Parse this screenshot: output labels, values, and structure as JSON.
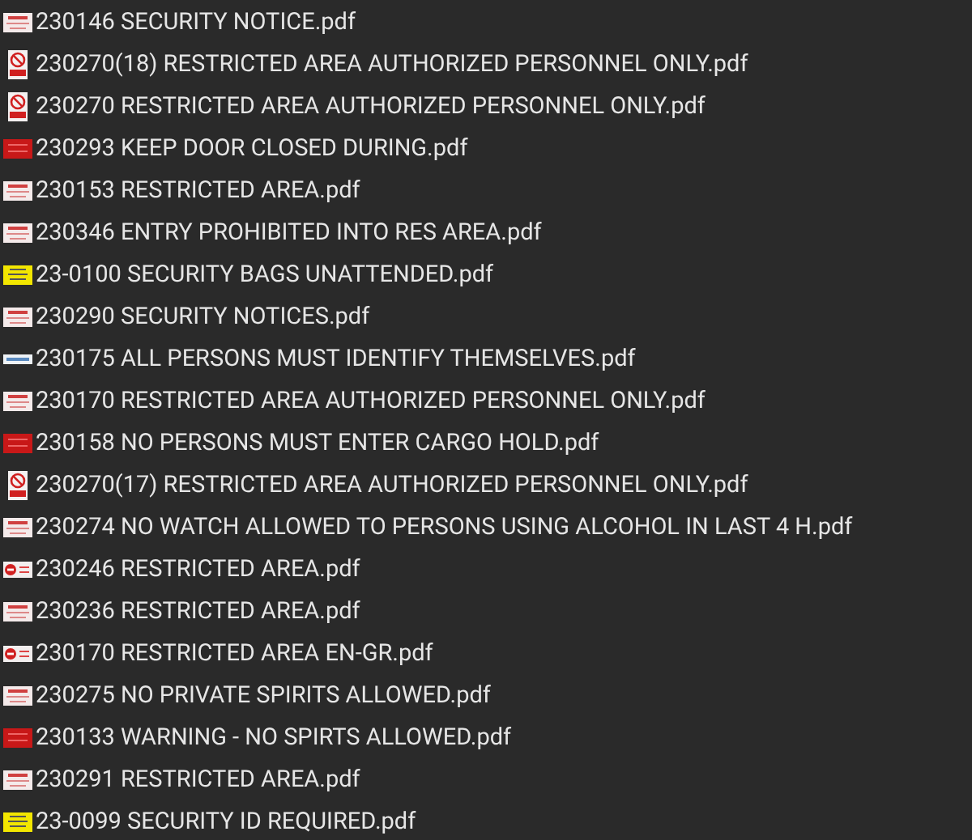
{
  "files": [
    {
      "name": "230146 SECURITY NOTICE.pdf",
      "kind": "white-sign"
    },
    {
      "name": "230270(18) RESTRICTED AREA AUTHORIZED PERSONNEL ONLY.pdf",
      "kind": "prohibition-sign"
    },
    {
      "name": "230270 RESTRICTED AREA AUTHORIZED PERSONNEL ONLY.pdf",
      "kind": "prohibition-sign"
    },
    {
      "name": "230293 KEEP DOOR CLOSED DURING.pdf",
      "kind": "red-sign"
    },
    {
      "name": "230153 RESTRICTED AREA.pdf",
      "kind": "white-sign"
    },
    {
      "name": "230346 ENTRY PROHIBITED INTO RES AREA.pdf",
      "kind": "white-sign"
    },
    {
      "name": "23-0100 SECURITY BAGS UNATTENDED.pdf",
      "kind": "yellow-sign"
    },
    {
      "name": "230290 SECURITY NOTICES.pdf",
      "kind": "white-sign"
    },
    {
      "name": "230175 ALL PERSONS MUST IDENTIFY THEMSELVES.pdf",
      "kind": "blue-strip"
    },
    {
      "name": "230170 RESTRICTED AREA AUTHORIZED PERSONNEL ONLY.pdf",
      "kind": "white-sign"
    },
    {
      "name": "230158 NO PERSONS MUST ENTER CARGO HOLD.pdf",
      "kind": "red-sign"
    },
    {
      "name": "230270(17) RESTRICTED AREA AUTHORIZED PERSONNEL ONLY.pdf",
      "kind": "prohibition-sign"
    },
    {
      "name": "230274 NO WATCH ALLOWED TO PERSONS USING ALCOHOL IN LAST 4 H.pdf",
      "kind": "white-sign"
    },
    {
      "name": "230246 RESTRICTED AREA.pdf",
      "kind": "stop-sign"
    },
    {
      "name": "230236 RESTRICTED AREA.pdf",
      "kind": "white-sign"
    },
    {
      "name": "230170 RESTRICTED AREA EN-GR.pdf",
      "kind": "stop-sign"
    },
    {
      "name": "230275 NO PRIVATE SPIRITS ALLOWED.pdf",
      "kind": "white-sign"
    },
    {
      "name": "230133 WARNING - NO SPIRTS ALLOWED.pdf",
      "kind": "red-sign"
    },
    {
      "name": "230291 RESTRICTED AREA.pdf",
      "kind": "white-sign"
    },
    {
      "name": "23-0099 SECURITY ID REQUIRED.pdf",
      "kind": "yellow-sign"
    }
  ]
}
